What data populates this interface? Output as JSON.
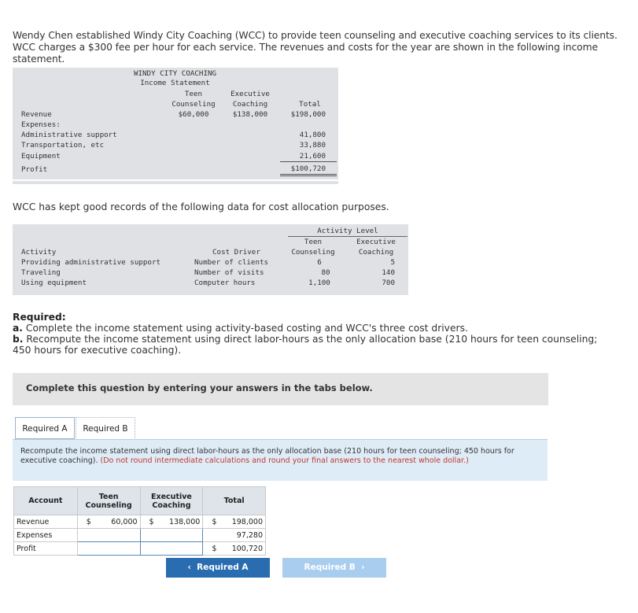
{
  "intro": "Wendy Chen established Windy City Coaching (WCC) to provide teen counseling and executive coaching services to its clients. WCC charges a $300 fee per hour for each service. The revenues and costs for the year are shown in the following income statement.",
  "income_statement": {
    "title1": "WINDY CITY COACHING",
    "title2": "Income Statement",
    "col_teen_1": "Teen",
    "col_teen_2": "Counseling",
    "col_exec_1": "Executive",
    "col_exec_2": "Coaching",
    "col_total": "Total",
    "revenue_label": "Revenue",
    "revenue_teen": "$60,000",
    "revenue_exec": "$138,000",
    "revenue_total": "$198,000",
    "expenses_label": "Expenses:",
    "rows": [
      {
        "label": "Administrative support",
        "total": "41,800"
      },
      {
        "label": "Transportation, etc",
        "total": "33,880"
      },
      {
        "label": "Equipment",
        "total": "21,600"
      }
    ],
    "profit_label": "Profit",
    "profit_total": "$100,720"
  },
  "records_text": "WCC has kept good records of the following data for cost allocation purposes.",
  "activity_table": {
    "group_header": "Activity Level",
    "col_activity": "Activity",
    "col_driver": "Cost Driver",
    "col_teen_1": "Teen",
    "col_teen_2": "Counseling",
    "col_exec_1": "Executive",
    "col_exec_2": "Coaching",
    "rows": [
      {
        "activity": "Providing administrative support",
        "driver": "Number of clients",
        "teen": "6",
        "exec": "5"
      },
      {
        "activity": "Traveling",
        "driver": "Number of visits",
        "teen": "80",
        "exec": "140"
      },
      {
        "activity": "Using equipment",
        "driver": "Computer hours",
        "teen": "1,100",
        "exec": "700"
      }
    ]
  },
  "required": {
    "heading": "Required:",
    "a_label": "a.",
    "a_text": "Complete the income statement using activity-based costing and WCC's three cost drivers.",
    "b_label": "b.",
    "b_text": "Recompute the income statement using direct labor-hours as the only allocation base (210 hours for teen counseling; 450 hours for executive coaching)."
  },
  "banner": "Complete this question by entering your answers in the tabs below.",
  "tabs": {
    "a": "Required A",
    "b": "Required B"
  },
  "instruction": {
    "main": "Recompute the income statement using direct labor-hours as the only allocation base (210 hours for teen counseling; 450 hours for executive coaching).",
    "note": "(Do not round intermediate calculations and round your final answers to the nearest whole dollar.)"
  },
  "answer_table": {
    "col_account": "Account",
    "col_teen_1": "Teen",
    "col_teen_2": "Counseling",
    "col_exec_1": "Executive",
    "col_exec_2": "Coaching",
    "col_total": "Total",
    "revenue_label": "Revenue",
    "currency": "$",
    "revenue_teen": "60,000",
    "revenue_exec": "138,000",
    "revenue_total": "198,000",
    "expenses_label": "Expenses",
    "expenses_total": "97,280",
    "profit_label": "Profit",
    "profit_total": "100,720"
  },
  "nav": {
    "prev": "Required A",
    "next": "Required B"
  }
}
